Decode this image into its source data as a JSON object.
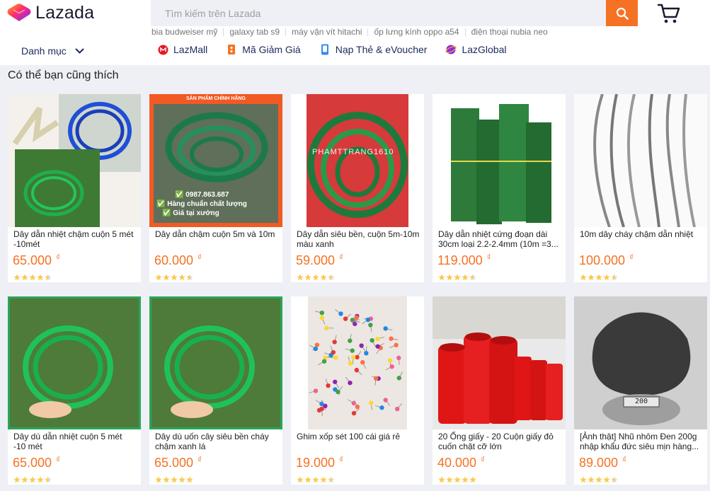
{
  "header": {
    "logo_text": "Lazada",
    "search_placeholder": "Tìm kiếm trên Lazada",
    "suggestions": [
      "bia budweiser mỹ",
      "galaxy tab s9",
      "máy vặn vít hitachi",
      "ốp lưng kính oppo a54",
      "điện thoại nubia neo"
    ],
    "category_label": "Danh mục",
    "nav": [
      {
        "label": "LazMall",
        "icon": "lazmall-icon",
        "color": "#e31b23"
      },
      {
        "label": "Mã Giảm Giá",
        "icon": "voucher-icon",
        "color": "#f57224"
      },
      {
        "label": "Nạp Thẻ & eVoucher",
        "icon": "topup-icon",
        "color": "#2d8cf0"
      },
      {
        "label": "LazGlobal",
        "icon": "lazglobal-icon",
        "color": "#8a2be2"
      }
    ]
  },
  "section_title": "Có thể bạn cũng thích",
  "currency": "₫",
  "products": [
    {
      "name": "Dây dẫn nhiệt chậm cuộn 5 mét -10mét",
      "price": "65.000",
      "rating": 4.5
    },
    {
      "name": "Dây dẫn chậm cuộn 5m và 10m",
      "price": "60.000",
      "rating": 4.5,
      "overlay": [
        "SẢN PHẨM CHÍNH HÃNG",
        "✅ 0987.863.687",
        "✅ Hàng chuẩn chất lượng",
        "✅ Giá tại xưởng"
      ]
    },
    {
      "name": "Dây dẫn siêu bền, cuộn 5m-10m màu xanh",
      "price": "59.000",
      "rating": 4.5,
      "watermark": "PHAMTTRANG1610"
    },
    {
      "name": "Dây dẫn nhiệt cứng đoạn dài 30cm loại 2.2-2.4mm (10m =3...",
      "price": "119.000",
      "rating": 4.5
    },
    {
      "name": "10m dây cháy chậm dẫn nhiệt",
      "price": "100.000",
      "rating": 4.5
    },
    {
      "name": "Dây dù dẫn nhiệt cuộn 5 mét -10 mét",
      "price": "65.000",
      "rating": 4.5
    },
    {
      "name": "Dây dù uốn cây siêu bền cháy chậm xanh lá",
      "price": "65.000",
      "rating": 5
    },
    {
      "name": "Ghim xốp sét 100 cái giá rẻ",
      "price": "19.000",
      "rating": 4.5
    },
    {
      "name": "20 Ống giấy - 20 Cuộn giấy đỏ cuốn chặt cỡ lớn",
      "price": "40.000",
      "rating": 5
    },
    {
      "name": "[Ảnh thật] Nhũ nhôm Đen 200g nhập khẩu đức siêu mịn hàng...",
      "price": "89.000",
      "rating": 4.5,
      "scale_reading": "200"
    }
  ],
  "colors": {
    "accent": "#f57224",
    "star": "#faca51",
    "nav_text": "#1a2a5c"
  }
}
